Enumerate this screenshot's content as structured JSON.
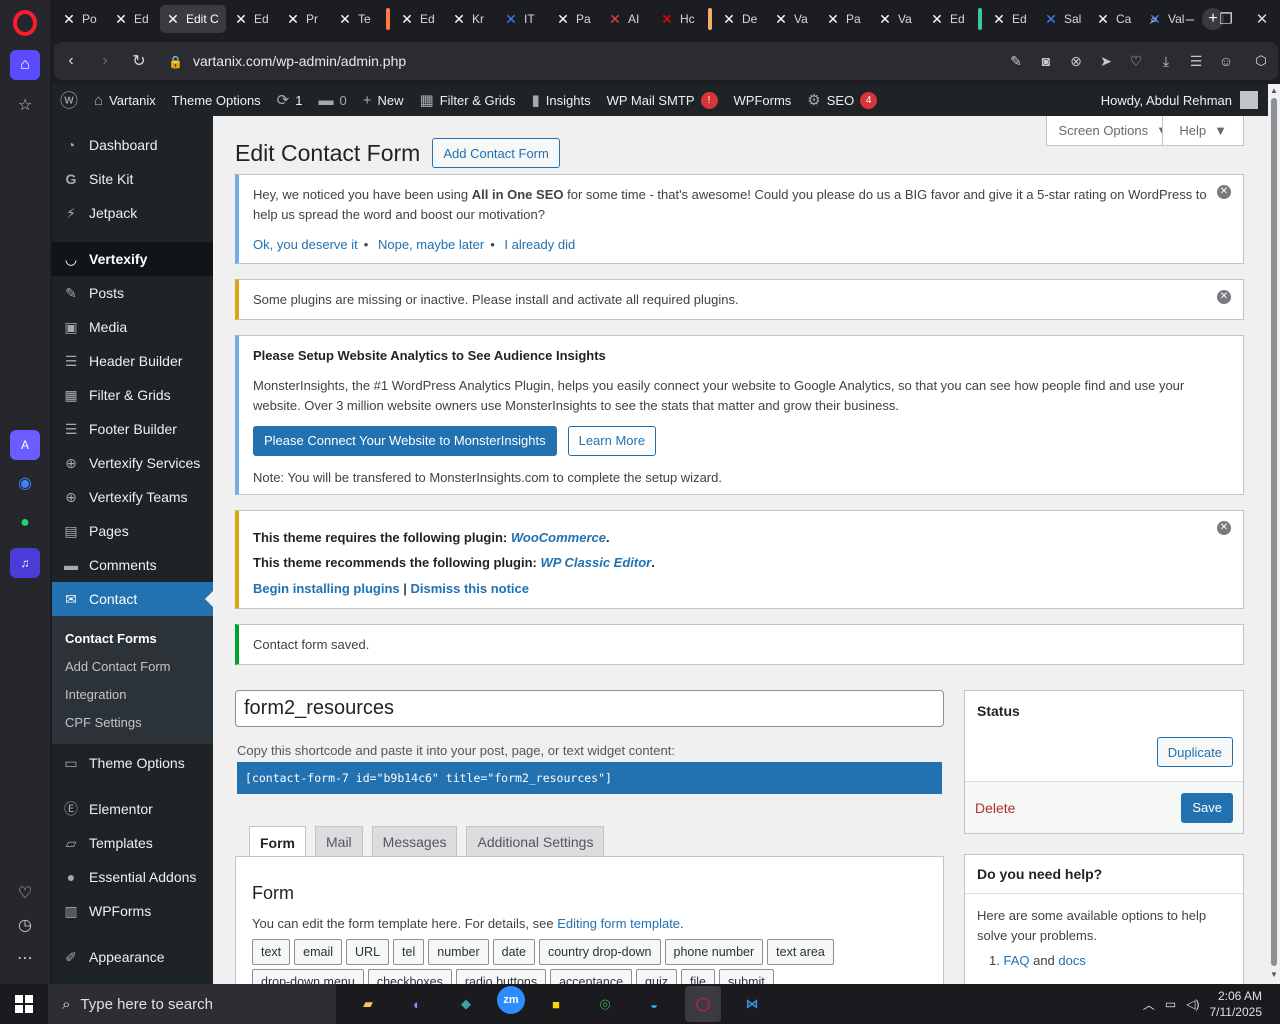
{
  "browser": {
    "tabs": [
      {
        "label": "Po",
        "color": "#ffffff"
      },
      {
        "label": "Ed",
        "color": "#ffffff"
      },
      {
        "label": "Edit C",
        "color": "#ffffff",
        "active": true
      },
      {
        "label": "Ed",
        "color": "#ffffff"
      },
      {
        "label": "Pr",
        "color": "#ffffff"
      },
      {
        "label": "Te",
        "color": "#ffffff"
      },
      {
        "label": "Ed",
        "color": "#ffffff"
      },
      {
        "label": "Kr",
        "color": "#ffffff"
      },
      {
        "label": "IT",
        "color": "#3b82f6"
      },
      {
        "label": "Pa",
        "color": "#ffffff"
      },
      {
        "label": "AI",
        "color": "#ea4335"
      },
      {
        "label": "Hc",
        "color": "#ff0000"
      },
      {
        "label": "De",
        "color": "#ffffff"
      },
      {
        "label": "Va",
        "color": "#ffffff"
      },
      {
        "label": "Pa",
        "color": "#ffffff"
      },
      {
        "label": "Va",
        "color": "#ffffff"
      },
      {
        "label": "Ed",
        "color": "#ffffff"
      },
      {
        "label": "Ed",
        "color": "#ffffff"
      },
      {
        "label": "Sal",
        "color": "#3b82f6"
      },
      {
        "label": "Ca",
        "color": "#ffffff"
      },
      {
        "label": "Val",
        "color": "#3b82f6"
      }
    ],
    "url": "vartanix.com/wp-admin/admin.php"
  },
  "adminbar": {
    "site": "Vartanix",
    "theme_options": "Theme Options",
    "updates_count": "1",
    "comments_count": "0",
    "new": "New",
    "filter_grids": "Filter & Grids",
    "insights": "Insights",
    "wp_mail_smtp": "WP Mail SMTP",
    "wp_mail_badge": "!",
    "wpforms": "WPForms",
    "seo": "SEO",
    "seo_badge": "4",
    "howdy": "Howdy, Abdul Rehman"
  },
  "sidebar": {
    "dashboard": "Dashboard",
    "site_kit": "Site Kit",
    "jetpack": "Jetpack",
    "vertexify": "Vertexify",
    "posts": "Posts",
    "media": "Media",
    "header_builder": "Header Builder",
    "filter_grids": "Filter & Grids",
    "footer_builder": "Footer Builder",
    "vertexify_services": "Vertexify Services",
    "vertexify_teams": "Vertexify Teams",
    "pages": "Pages",
    "comments": "Comments",
    "contact": "Contact",
    "sub_contact_forms": "Contact Forms",
    "sub_add_contact_form": "Add Contact Form",
    "sub_integration": "Integration",
    "sub_cpf_settings": "CPF Settings",
    "theme_options": "Theme Options",
    "elementor": "Elementor",
    "templates": "Templates",
    "essential_addons": "Essential Addons",
    "wpforms": "WPForms",
    "appearance": "Appearance"
  },
  "header": {
    "screen_options": "Screen Options",
    "help": "Help",
    "title": "Edit Contact Form",
    "add_button": "Add Contact Form"
  },
  "notices": {
    "aioseo_pre": "Hey, we noticed you have been using ",
    "aioseo_brand": "All in One SEO",
    "aioseo_post": " for some time - that's awesome! Could you please do us a BIG favor and give it a 5-star rating on WordPress to help us spread the word and boost our motivation?",
    "aioseo_link1": "Ok, you deserve it",
    "aioseo_link2": "Nope, maybe later",
    "aioseo_link3": "I already did",
    "plugins_missing": "Some plugins are missing or inactive. Please install and activate all required plugins.",
    "mi_title": "Please Setup Website Analytics to See Audience Insights",
    "mi_body": "MonsterInsights, the #1 WordPress Analytics Plugin, helps you easily connect your website to Google Analytics, so that you can see how people find and use your website. Over 3 million website owners use MonsterInsights to see the stats that matter and grow their business.",
    "mi_connect": "Please Connect Your Website to MonsterInsights",
    "mi_learn": "Learn More",
    "mi_note": "Note: You will be transfered to MonsterInsights.com to complete the setup wizard.",
    "tgm_req_pre": "This theme requires the following plugin: ",
    "tgm_req_plugin": "WooCommerce",
    "tgm_rec_pre": "This theme recommends the following plugin: ",
    "tgm_rec_plugin": "WP Classic Editor",
    "tgm_begin": "Begin installing plugins",
    "tgm_sep": " | ",
    "tgm_dismiss": "Dismiss this notice",
    "saved": "Contact form saved."
  },
  "form": {
    "title_value": "form2_resources",
    "shortcode_label": "Copy this shortcode and paste it into your post, page, or text widget content:",
    "shortcode": "[contact-form-7 id=\"b9b14c6\" title=\"form2_resources\"]",
    "tabs": [
      "Form",
      "Mail",
      "Messages",
      "Additional Settings"
    ],
    "panel_title": "Form",
    "panel_desc_pre": "You can edit the form template here. For details, see ",
    "panel_desc_link": "Editing form template",
    "panel_desc_post": ".",
    "tags": [
      "text",
      "email",
      "URL",
      "tel",
      "number",
      "date",
      "country drop-down",
      "phone number",
      "text area",
      "drop-down menu",
      "checkboxes",
      "radio buttons",
      "acceptance",
      "quiz",
      "file",
      "submit"
    ]
  },
  "status": {
    "title": "Status",
    "duplicate": "Duplicate",
    "delete": "Delete",
    "save": "Save"
  },
  "helpbox": {
    "title": "Do you need help?",
    "body": "Here are some available options to help solve your problems.",
    "item1_num": "1.",
    "item1_link1": "FAQ",
    "item1_and": " and ",
    "item1_link2": "docs"
  },
  "taskbar": {
    "search_placeholder": "Type here to search",
    "time": "2:06 AM",
    "date": "7/11/2025"
  }
}
